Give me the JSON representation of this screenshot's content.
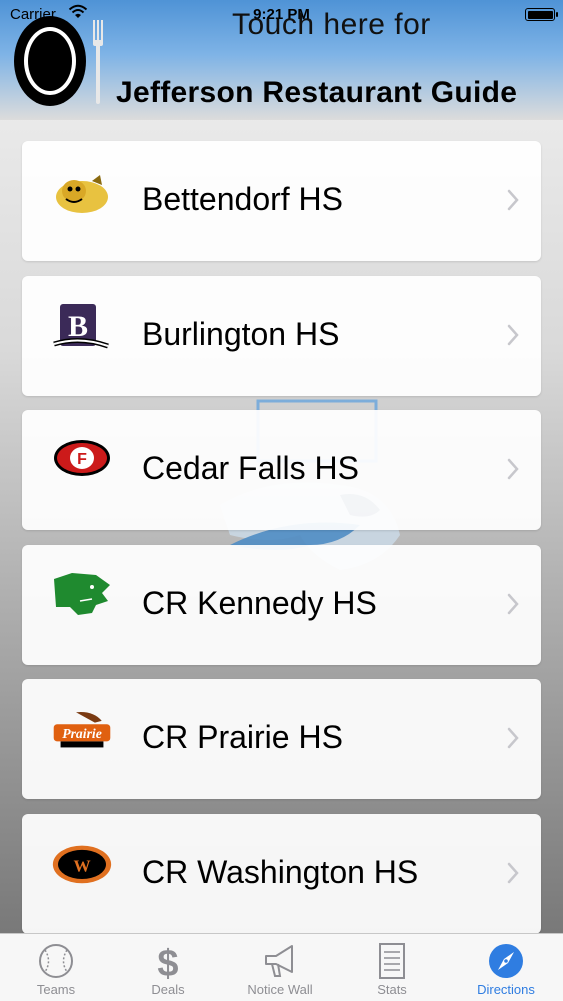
{
  "status_bar": {
    "carrier": "Carrier",
    "time": "9:21 PM"
  },
  "header": {
    "line1": "Touch here for",
    "line2": "Jefferson Restaurant Guide"
  },
  "schools": [
    {
      "name": "Bettendorf HS",
      "icon": "bulldog-logo-icon"
    },
    {
      "name": "Burlington HS",
      "icon": "b-greyhounds-logo-icon"
    },
    {
      "name": "Cedar Falls HS",
      "icon": "cf-logo-icon"
    },
    {
      "name": "CR Kennedy HS",
      "icon": "cougar-logo-icon"
    },
    {
      "name": "CR Prairie HS",
      "icon": "prairie-hawks-logo-icon"
    },
    {
      "name": "CR Washington HS",
      "icon": "washington-logo-icon"
    }
  ],
  "tabs": [
    {
      "label": "Teams",
      "icon": "baseball-icon"
    },
    {
      "label": "Deals",
      "icon": "dollar-icon"
    },
    {
      "label": "Notice Wall",
      "icon": "megaphone-icon"
    },
    {
      "label": "Stats",
      "icon": "document-icon"
    },
    {
      "label": "Directions",
      "icon": "compass-icon"
    }
  ],
  "colors": {
    "accent": "#2f7de1",
    "header_blue": "#4f93d6",
    "inactive": "#8e8e93"
  }
}
